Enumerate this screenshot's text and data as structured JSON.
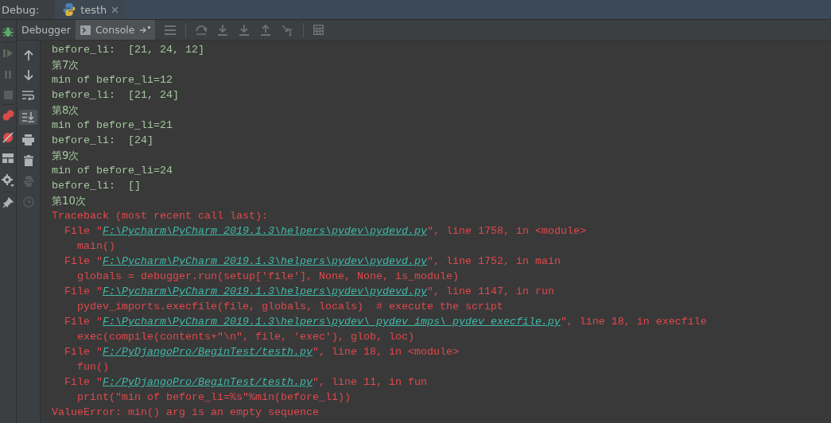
{
  "window": {
    "title": "Debug:",
    "tab": {
      "label": "testh"
    }
  },
  "tabs": [
    {
      "label": "Debugger",
      "selected": false
    },
    {
      "label": "Console",
      "selected": true
    }
  ],
  "console": {
    "lines": [
      {
        "kind": "output",
        "text": "before_li:  [21, 24, 12]"
      },
      {
        "kind": "output",
        "text": "第7次"
      },
      {
        "kind": "output",
        "text": "min of before_li=12"
      },
      {
        "kind": "output",
        "text": "before_li:  [21, 24]"
      },
      {
        "kind": "output",
        "text": "第8次"
      },
      {
        "kind": "output",
        "text": "min of before_li=21"
      },
      {
        "kind": "output",
        "text": "before_li:  [24]"
      },
      {
        "kind": "output",
        "text": "第9次"
      },
      {
        "kind": "output",
        "text": "min of before_li=24"
      },
      {
        "kind": "output",
        "text": "before_li:  []"
      },
      {
        "kind": "output",
        "text": "第10次"
      },
      {
        "kind": "error",
        "text": "Traceback (most recent call last):"
      },
      {
        "kind": "frame",
        "prefix": "  File \"",
        "path": "F:\\Pycharm\\PyCharm 2019.1.3\\helpers\\pydev\\pydevd.py",
        "suffix": "\", line 1758, in <module>"
      },
      {
        "kind": "error",
        "text": "    main()"
      },
      {
        "kind": "frame",
        "prefix": "  File \"",
        "path": "F:\\Pycharm\\PyCharm 2019.1.3\\helpers\\pydev\\pydevd.py",
        "suffix": "\", line 1752, in main"
      },
      {
        "kind": "error",
        "text": "    globals = debugger.run(setup['file'], None, None, is_module)"
      },
      {
        "kind": "frame",
        "prefix": "  File \"",
        "path": "F:\\Pycharm\\PyCharm 2019.1.3\\helpers\\pydev\\pydevd.py",
        "suffix": "\", line 1147, in run"
      },
      {
        "kind": "error",
        "text": "    pydev_imports.execfile(file, globals, locals)  # execute the script"
      },
      {
        "kind": "frame",
        "prefix": "  File \"",
        "path": "F:\\Pycharm\\PyCharm 2019.1.3\\helpers\\pydev\\_pydev_imps\\_pydev_execfile.py",
        "suffix": "\", line 18, in execfile"
      },
      {
        "kind": "error",
        "text": "    exec(compile(contents+\"\\n\", file, 'exec'), glob, loc)"
      },
      {
        "kind": "frame",
        "prefix": "  File \"",
        "path": "F:/PyDjangoPro/BeginTest/testh.py",
        "suffix": "\", line 18, in <module>"
      },
      {
        "kind": "error",
        "text": "    fun()"
      },
      {
        "kind": "frame",
        "prefix": "  File \"",
        "path": "F:/PyDjangoPro/BeginTest/testh.py",
        "suffix": "\", line 11, in fun"
      },
      {
        "kind": "error",
        "text": "    print(\"min of before_li=%s\"%min(before_li))"
      },
      {
        "kind": "error",
        "text": "ValueError: min() arg is an empty sequence"
      }
    ]
  }
}
